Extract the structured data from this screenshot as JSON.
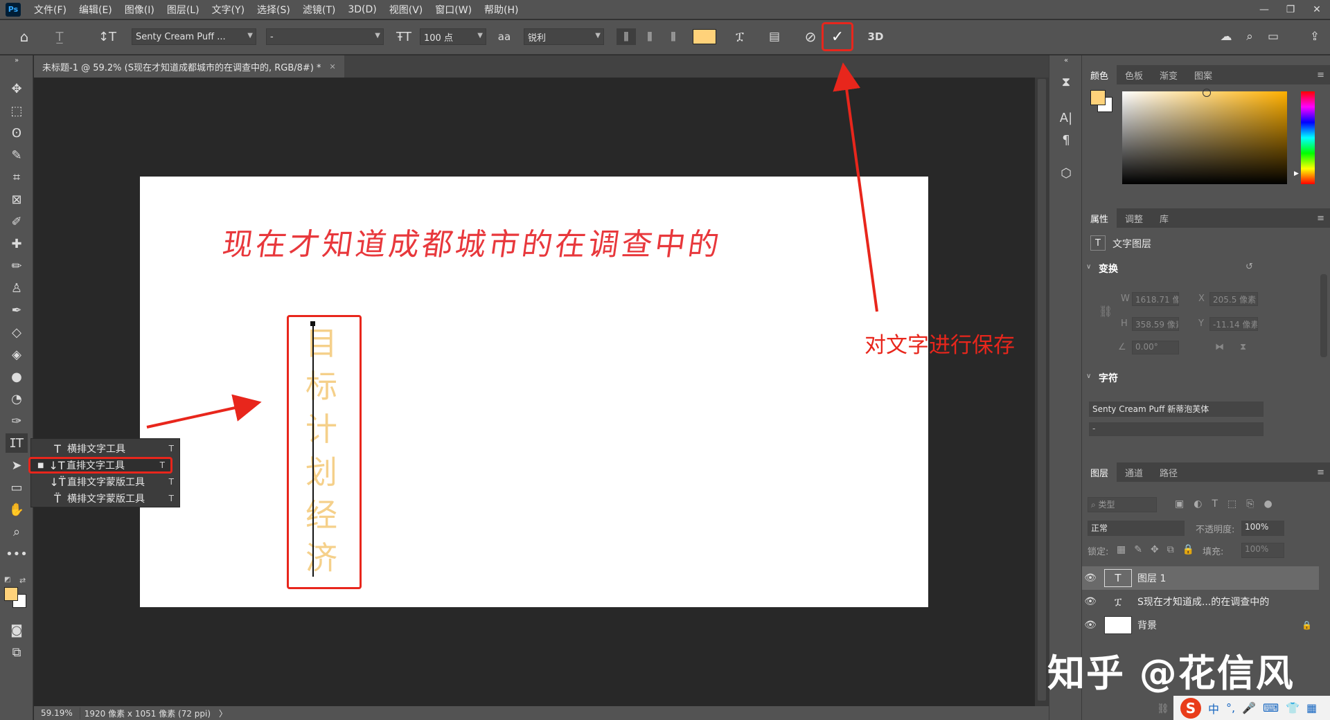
{
  "app": {
    "logo": "Ps"
  },
  "menu": [
    "文件(F)",
    "编辑(E)",
    "图像(I)",
    "图层(L)",
    "文字(Y)",
    "选择(S)",
    "滤镜(T)",
    "3D(D)",
    "视图(V)",
    "窗口(W)",
    "帮助(H)"
  ],
  "window_controls": [
    "—",
    "❐",
    "✕"
  ],
  "options": {
    "font_family": "Senty Cream Puff ...",
    "font_style": "-",
    "font_size": "100 点",
    "aa_icon": "aa",
    "antialias": "锐利",
    "color_swatch": "#ffd27a",
    "cancel_icon": "cancel-icon",
    "commit_icon": "commit-checkmark-icon",
    "three_d": "3D"
  },
  "document": {
    "tab_title": "未标题-1 @ 59.2% (S现在才知道成都城市的在调查中的, RGB/8#) *",
    "tab_close": "✕",
    "horizontal_text": "现在才知道成都城市的在调查中的",
    "vertical_chars": [
      "目",
      "标",
      "计",
      "划",
      "经",
      "济"
    ],
    "vertical_text_color": "#f5d08a",
    "horizontal_text_color": "#e8383c"
  },
  "status": {
    "zoom": "59.19%",
    "doc_info": "1920 像素 x 1051 像素 (72 ppi)",
    "arrow": "〉"
  },
  "flyout": [
    {
      "icon": "T",
      "label": "横排文字工具",
      "key": "T"
    },
    {
      "icon": "↓T",
      "label": "直排文字工具",
      "key": "T",
      "selected": true
    },
    {
      "icon": "↓T̈",
      "label": "直排文字蒙版工具",
      "key": "T"
    },
    {
      "icon": "T̈",
      "label": "横排文字蒙版工具",
      "key": "T"
    }
  ],
  "annotation": {
    "text": "对文字进行保存",
    "color": "#e8261c"
  },
  "panels": {
    "color_tabs": [
      "颜色",
      "色板",
      "渐变",
      "图案"
    ],
    "fg_color": "#ffd27a",
    "prop_tabs": [
      "属性",
      "调整",
      "库"
    ],
    "layer_type": "文字图层",
    "transform": {
      "title": "变换",
      "w_label": "W",
      "w": "1618.71 像",
      "x_label": "X",
      "x": "205.5 像素",
      "h_label": "H",
      "h": "358.59 像素",
      "y_label": "Y",
      "y": "-11.14 像素",
      "angle": "0.00°"
    },
    "character": {
      "title": "字符",
      "font": "Senty Cream Puff 新蒂泡芙体",
      "style": "-"
    },
    "layer_tabs": [
      "图层",
      "通道",
      "路径"
    ],
    "layers_filter": "类型",
    "blend_mode": "正常",
    "opacity_label": "不透明度:",
    "opacity": "100%",
    "lock_label": "锁定:",
    "fill_label": "填充:",
    "fill": "100%",
    "layers": [
      {
        "name": "图层 1",
        "type": "text",
        "selected": true
      },
      {
        "name": "S现在才知道成...的在调查中的",
        "type": "vtext"
      },
      {
        "name": "背景",
        "type": "bg",
        "locked": true
      }
    ]
  },
  "watermark": "知乎 @花信风",
  "ime": {
    "logo": "S",
    "items": [
      "中",
      "°,",
      "🎤",
      "⌨",
      "👕",
      "▦"
    ]
  }
}
